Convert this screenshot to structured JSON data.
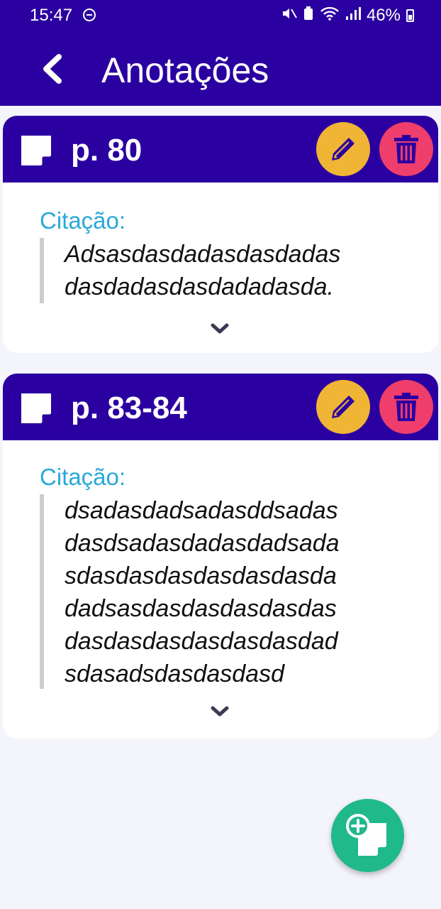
{
  "status_bar": {
    "time": "15:47",
    "battery": "46%"
  },
  "header": {
    "title": "Anotações"
  },
  "notes": [
    {
      "page": "p. 80",
      "citation_label": "Citação:",
      "text": "Adsasdasdadasdasdadas\ndasdadasdasdadadasda."
    },
    {
      "page": "p. 83-84",
      "citation_label": "Citação:",
      "text": "dsadasdadsadasddsadas\ndasdsadasdadasdadsada\nsdasdasdasdasdasdasda\ndadsasdasdasdasdasdas\ndasdasdasdasdasdasdad\nsdasadsdasdasdasd"
    }
  ],
  "colors": {
    "primary": "#2b00a0",
    "edit": "#f0b535",
    "delete": "#ef3e6b",
    "citation": "#2aa8d8",
    "fab": "#1fb98a"
  },
  "icons": {
    "back": "chevron-left-icon",
    "note": "sticky-note-icon",
    "edit": "pencil-icon",
    "delete": "trash-icon",
    "expand": "chevron-down-icon",
    "add": "add-note-icon"
  }
}
